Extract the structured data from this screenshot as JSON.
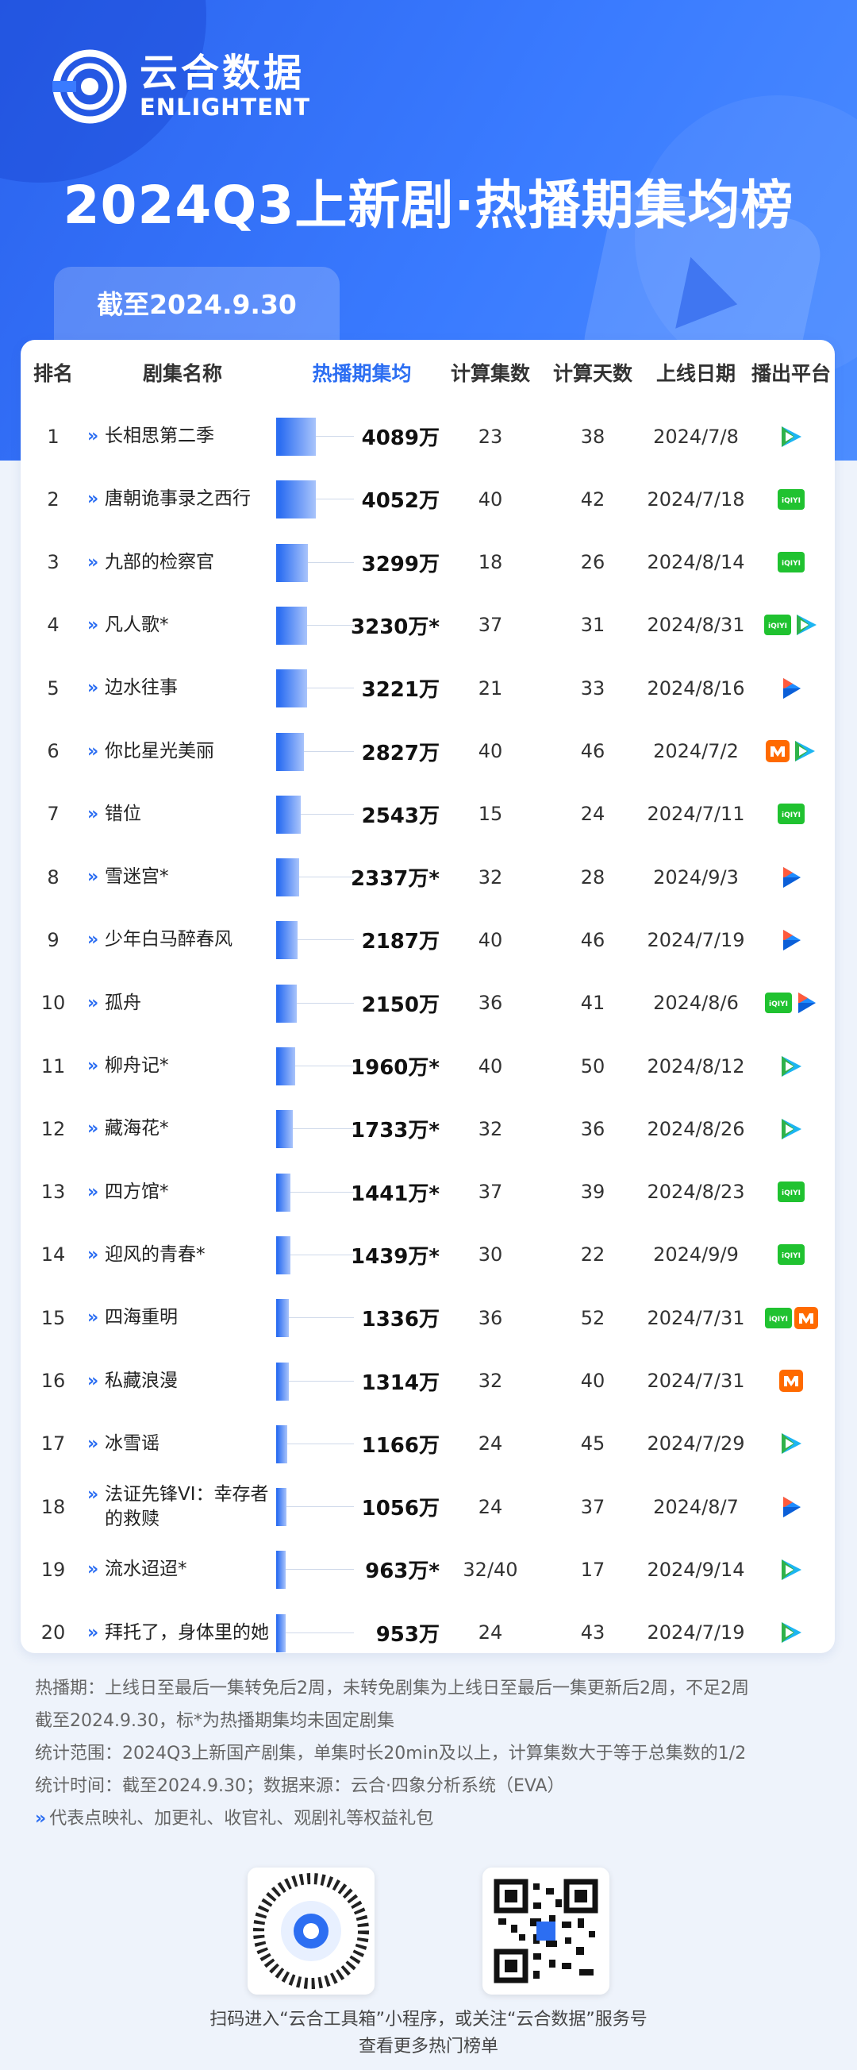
{
  "brand": {
    "name_cn": "云合数据",
    "name_en": "ENLIGHTENT"
  },
  "title": "2024Q3上新剧·热播期集均榜",
  "date_label": "截至2024.9.30",
  "colors": {
    "accent": "#2c6ef2",
    "header_bg": "#3a7bff",
    "iqiyi": "#20c230",
    "tencent_green": "#2fb24a",
    "tencent_blue": "#1db5f2",
    "youku": "#1f8cff",
    "mango": "#ff6a00"
  },
  "table": {
    "headers": [
      "排名",
      "剧集名称",
      "热播期集均",
      "计算集数",
      "计算天数",
      "上线日期",
      "播出平台"
    ],
    "rows": [
      {
        "rank": "1",
        "name": "长相思第二季",
        "value": "4089万",
        "value_num": 4089,
        "episodes": "23",
        "days": "38",
        "date": "2024/7/8",
        "platforms": [
          "tencent"
        ]
      },
      {
        "rank": "2",
        "name": "唐朝诡事录之西行",
        "value": "4052万",
        "value_num": 4052,
        "episodes": "40",
        "days": "42",
        "date": "2024/7/18",
        "platforms": [
          "iqiyi"
        ]
      },
      {
        "rank": "3",
        "name": "九部的检察官",
        "value": "3299万",
        "value_num": 3299,
        "episodes": "18",
        "days": "26",
        "date": "2024/8/14",
        "platforms": [
          "iqiyi"
        ]
      },
      {
        "rank": "4",
        "name": "凡人歌*",
        "value": "3230万*",
        "value_num": 3230,
        "episodes": "37",
        "days": "31",
        "date": "2024/8/31",
        "platforms": [
          "iqiyi",
          "tencent"
        ]
      },
      {
        "rank": "5",
        "name": "边水往事",
        "value": "3221万",
        "value_num": 3221,
        "episodes": "21",
        "days": "33",
        "date": "2024/8/16",
        "platforms": [
          "youku"
        ]
      },
      {
        "rank": "6",
        "name": "你比星光美丽",
        "value": "2827万",
        "value_num": 2827,
        "episodes": "40",
        "days": "46",
        "date": "2024/7/2",
        "platforms": [
          "mango",
          "tencent"
        ]
      },
      {
        "rank": "7",
        "name": "错位",
        "value": "2543万",
        "value_num": 2543,
        "episodes": "15",
        "days": "24",
        "date": "2024/7/11",
        "platforms": [
          "iqiyi"
        ]
      },
      {
        "rank": "8",
        "name": "雪迷宫*",
        "value": "2337万*",
        "value_num": 2337,
        "episodes": "32",
        "days": "28",
        "date": "2024/9/3",
        "platforms": [
          "youku"
        ]
      },
      {
        "rank": "9",
        "name": "少年白马醉春风",
        "value": "2187万",
        "value_num": 2187,
        "episodes": "40",
        "days": "46",
        "date": "2024/7/19",
        "platforms": [
          "youku"
        ]
      },
      {
        "rank": "10",
        "name": "孤舟",
        "value": "2150万",
        "value_num": 2150,
        "episodes": "36",
        "days": "41",
        "date": "2024/8/6",
        "platforms": [
          "iqiyi",
          "youku"
        ]
      },
      {
        "rank": "11",
        "name": "柳舟记*",
        "value": "1960万*",
        "value_num": 1960,
        "episodes": "40",
        "days": "50",
        "date": "2024/8/12",
        "platforms": [
          "tencent"
        ]
      },
      {
        "rank": "12",
        "name": "藏海花*",
        "value": "1733万*",
        "value_num": 1733,
        "episodes": "32",
        "days": "36",
        "date": "2024/8/26",
        "platforms": [
          "tencent"
        ]
      },
      {
        "rank": "13",
        "name": "四方馆*",
        "value": "1441万*",
        "value_num": 1441,
        "episodes": "37",
        "days": "39",
        "date": "2024/8/23",
        "platforms": [
          "iqiyi"
        ]
      },
      {
        "rank": "14",
        "name": "迎风的青春*",
        "value": "1439万*",
        "value_num": 1439,
        "episodes": "30",
        "days": "22",
        "date": "2024/9/9",
        "platforms": [
          "iqiyi"
        ]
      },
      {
        "rank": "15",
        "name": "四海重明",
        "value": "1336万",
        "value_num": 1336,
        "episodes": "36",
        "days": "52",
        "date": "2024/7/31",
        "platforms": [
          "iqiyi",
          "mango"
        ]
      },
      {
        "rank": "16",
        "name": "私藏浪漫",
        "value": "1314万",
        "value_num": 1314,
        "episodes": "32",
        "days": "40",
        "date": "2024/7/31",
        "platforms": [
          "mango"
        ]
      },
      {
        "rank": "17",
        "name": "冰雪谣",
        "value": "1166万",
        "value_num": 1166,
        "episodes": "24",
        "days": "45",
        "date": "2024/7/29",
        "platforms": [
          "tencent"
        ]
      },
      {
        "rank": "18",
        "name": "法证先锋VI：幸存者的救赎",
        "value": "1056万",
        "value_num": 1056,
        "episodes": "24",
        "days": "37",
        "date": "2024/8/7",
        "platforms": [
          "youku"
        ]
      },
      {
        "rank": "19",
        "name": "流水迢迢*",
        "value": "963万*",
        "value_num": 963,
        "episodes": "32/40",
        "days": "17",
        "date": "2024/9/14",
        "platforms": [
          "tencent"
        ]
      },
      {
        "rank": "20",
        "name": "拜托了，身体里的她",
        "value": "953万",
        "value_num": 953,
        "episodes": "24",
        "days": "43",
        "date": "2024/7/19",
        "platforms": [
          "tencent"
        ]
      }
    ]
  },
  "notes": {
    "line1": "热播期：上线日至最后一集转免后2周，未转免剧集为上线日至最后一集更新后2周，不足2周",
    "line2": "截至2024.9.30，标*为热播期集均未固定剧集",
    "line3": "统计范围：2024Q3上新国产剧集，单集时长20min及以上，计算集数大于等于总集数的1/2",
    "line4": "统计时间：截至2024.9.30；数据来源：云合·四象分析系统（EVA）",
    "line5": "代表点映礼、加更礼、收官礼、观剧礼等权益礼包"
  },
  "footer": {
    "line1": "扫码进入“云合工具箱”小程序，或关注“云合数据”服务号",
    "line2": "查看更多热门榜单"
  }
}
